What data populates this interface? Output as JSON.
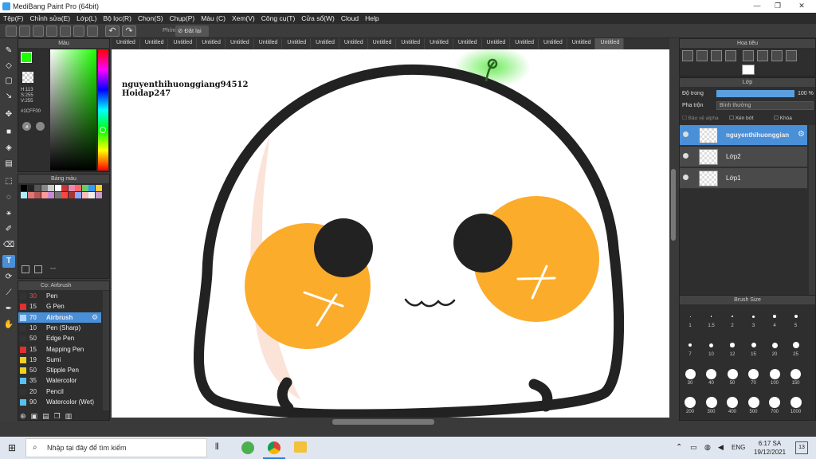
{
  "window": {
    "title": "MediBang Paint Pro (64bit)"
  },
  "menu": [
    "Tệp(F)",
    "Chỉnh sửa(E)",
    "Lớp(L)",
    "Bộ lọc(R)",
    "Chọn(S)",
    "Chụp(P)",
    "Màu (C)",
    "Xem(V)",
    "Công cụ(T)",
    "Cửa sổ(W)",
    "Cloud",
    "Help"
  ],
  "toolbar": {
    "key_label": "Phím",
    "reset_label": "Đặt lại"
  },
  "tabs": [
    "Untitled",
    "Untitled",
    "Untitled",
    "Untitled",
    "Untitled",
    "Untitled",
    "Untitled",
    "Untitled",
    "Untitled",
    "Untitled",
    "Untitled",
    "Untitled",
    "Untitled",
    "Untitled",
    "Untitled",
    "Untitled",
    "Untitled",
    "Untitled"
  ],
  "color_panel": {
    "title": "Màu",
    "h": "H:113",
    "s": "S:255",
    "v": "V:255",
    "hex": "#1CFF00",
    "primary": "#1CFF00"
  },
  "palette_panel": {
    "title": "Bảng màu",
    "more": "---"
  },
  "brush_panel": {
    "title": "Cọ: Airbrush",
    "items": [
      {
        "size": "30",
        "name": "Pen",
        "color": "#333333",
        "sizecolor": "#e05050"
      },
      {
        "size": "15",
        "name": "G Pen",
        "color": "#e03030",
        "sizecolor": "#dddddd"
      },
      {
        "size": "70",
        "name": "Airbrush",
        "color": "#aad8ff",
        "sizecolor": "#dddddd",
        "selected": true
      },
      {
        "size": "10",
        "name": "Pen (Sharp)",
        "color": "#333333",
        "sizecolor": "#dddddd"
      },
      {
        "size": "50",
        "name": "Edge Pen",
        "color": "#333333",
        "sizecolor": "#dddddd"
      },
      {
        "size": "15",
        "name": "Mapping Pen",
        "color": "#e03030",
        "sizecolor": "#dddddd"
      },
      {
        "size": "19",
        "name": "Sumi",
        "color": "#f0d020",
        "sizecolor": "#dddddd"
      },
      {
        "size": "50",
        "name": "Stipple Pen",
        "color": "#f0d020",
        "sizecolor": "#dddddd"
      },
      {
        "size": "35",
        "name": "Watercolor",
        "color": "#58c0f0",
        "sizecolor": "#dddddd"
      },
      {
        "size": "20",
        "name": "Pencil",
        "color": "#333333",
        "sizecolor": "#dddddd"
      },
      {
        "size": "90",
        "name": "Watercolor (Wet)",
        "color": "#58c0f0",
        "sizecolor": "#dddddd"
      }
    ]
  },
  "canvas": {
    "text_line1": "nguyenthihuonggiang94512",
    "text_line2": "Hoidap247"
  },
  "navigator": {
    "title": "Hoa tiêu"
  },
  "layer_panel": {
    "title": "Lớp",
    "opacity_label": "Độ trong",
    "opacity_value": "100 %",
    "blend_label": "Pha trộn",
    "blend_value": "Bình thường",
    "protect_alpha": "Bảo vệ alpha",
    "clipping": "Xén bớt",
    "lock": "Khóa",
    "layers": [
      {
        "name": "nguyenthihuonggian",
        "active": true
      },
      {
        "name": "Lớp2",
        "active": false
      },
      {
        "name": "Lớp1",
        "active": false
      }
    ]
  },
  "brush_size_panel": {
    "title": "Brush Size",
    "sizes": [
      "1",
      "1.5",
      "2",
      "3",
      "4",
      "5",
      "7",
      "10",
      "12",
      "15",
      "20",
      "25",
      "30",
      "40",
      "50",
      "70",
      "100",
      "150",
      "200",
      "300",
      "400",
      "500",
      "700",
      "1000"
    ]
  },
  "taskbar": {
    "search_placeholder": "Nhập tại đây để tìm kiếm",
    "lang": "ENG",
    "time": "6:17 SA",
    "date": "19/12/2021",
    "notif_count": "13"
  },
  "colors": {
    "cheek": "#FBAC2B",
    "outline": "#222222",
    "blush": "#FBE3D8",
    "accent": "#4a90d9"
  }
}
